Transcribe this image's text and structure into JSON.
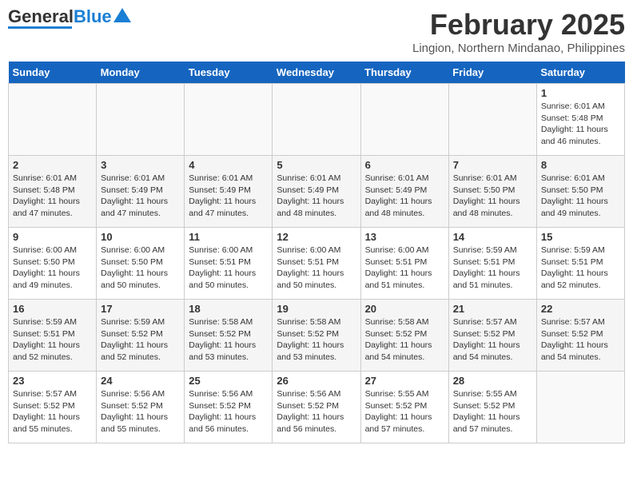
{
  "header": {
    "logo_text_general": "General",
    "logo_text_blue": "Blue",
    "month_year": "February 2025",
    "location": "Lingion, Northern Mindanao, Philippines"
  },
  "weekdays": [
    "Sunday",
    "Monday",
    "Tuesday",
    "Wednesday",
    "Thursday",
    "Friday",
    "Saturday"
  ],
  "weeks": [
    [
      {
        "day": "",
        "info": ""
      },
      {
        "day": "",
        "info": ""
      },
      {
        "day": "",
        "info": ""
      },
      {
        "day": "",
        "info": ""
      },
      {
        "day": "",
        "info": ""
      },
      {
        "day": "",
        "info": ""
      },
      {
        "day": "1",
        "info": "Sunrise: 6:01 AM\nSunset: 5:48 PM\nDaylight: 11 hours and 46 minutes."
      }
    ],
    [
      {
        "day": "2",
        "info": "Sunrise: 6:01 AM\nSunset: 5:48 PM\nDaylight: 11 hours and 47 minutes."
      },
      {
        "day": "3",
        "info": "Sunrise: 6:01 AM\nSunset: 5:49 PM\nDaylight: 11 hours and 47 minutes."
      },
      {
        "day": "4",
        "info": "Sunrise: 6:01 AM\nSunset: 5:49 PM\nDaylight: 11 hours and 47 minutes."
      },
      {
        "day": "5",
        "info": "Sunrise: 6:01 AM\nSunset: 5:49 PM\nDaylight: 11 hours and 48 minutes."
      },
      {
        "day": "6",
        "info": "Sunrise: 6:01 AM\nSunset: 5:49 PM\nDaylight: 11 hours and 48 minutes."
      },
      {
        "day": "7",
        "info": "Sunrise: 6:01 AM\nSunset: 5:50 PM\nDaylight: 11 hours and 48 minutes."
      },
      {
        "day": "8",
        "info": "Sunrise: 6:01 AM\nSunset: 5:50 PM\nDaylight: 11 hours and 49 minutes."
      }
    ],
    [
      {
        "day": "9",
        "info": "Sunrise: 6:00 AM\nSunset: 5:50 PM\nDaylight: 11 hours and 49 minutes."
      },
      {
        "day": "10",
        "info": "Sunrise: 6:00 AM\nSunset: 5:50 PM\nDaylight: 11 hours and 50 minutes."
      },
      {
        "day": "11",
        "info": "Sunrise: 6:00 AM\nSunset: 5:51 PM\nDaylight: 11 hours and 50 minutes."
      },
      {
        "day": "12",
        "info": "Sunrise: 6:00 AM\nSunset: 5:51 PM\nDaylight: 11 hours and 50 minutes."
      },
      {
        "day": "13",
        "info": "Sunrise: 6:00 AM\nSunset: 5:51 PM\nDaylight: 11 hours and 51 minutes."
      },
      {
        "day": "14",
        "info": "Sunrise: 5:59 AM\nSunset: 5:51 PM\nDaylight: 11 hours and 51 minutes."
      },
      {
        "day": "15",
        "info": "Sunrise: 5:59 AM\nSunset: 5:51 PM\nDaylight: 11 hours and 52 minutes."
      }
    ],
    [
      {
        "day": "16",
        "info": "Sunrise: 5:59 AM\nSunset: 5:51 PM\nDaylight: 11 hours and 52 minutes."
      },
      {
        "day": "17",
        "info": "Sunrise: 5:59 AM\nSunset: 5:52 PM\nDaylight: 11 hours and 52 minutes."
      },
      {
        "day": "18",
        "info": "Sunrise: 5:58 AM\nSunset: 5:52 PM\nDaylight: 11 hours and 53 minutes."
      },
      {
        "day": "19",
        "info": "Sunrise: 5:58 AM\nSunset: 5:52 PM\nDaylight: 11 hours and 53 minutes."
      },
      {
        "day": "20",
        "info": "Sunrise: 5:58 AM\nSunset: 5:52 PM\nDaylight: 11 hours and 54 minutes."
      },
      {
        "day": "21",
        "info": "Sunrise: 5:57 AM\nSunset: 5:52 PM\nDaylight: 11 hours and 54 minutes."
      },
      {
        "day": "22",
        "info": "Sunrise: 5:57 AM\nSunset: 5:52 PM\nDaylight: 11 hours and 54 minutes."
      }
    ],
    [
      {
        "day": "23",
        "info": "Sunrise: 5:57 AM\nSunset: 5:52 PM\nDaylight: 11 hours and 55 minutes."
      },
      {
        "day": "24",
        "info": "Sunrise: 5:56 AM\nSunset: 5:52 PM\nDaylight: 11 hours and 55 minutes."
      },
      {
        "day": "25",
        "info": "Sunrise: 5:56 AM\nSunset: 5:52 PM\nDaylight: 11 hours and 56 minutes."
      },
      {
        "day": "26",
        "info": "Sunrise: 5:56 AM\nSunset: 5:52 PM\nDaylight: 11 hours and 56 minutes."
      },
      {
        "day": "27",
        "info": "Sunrise: 5:55 AM\nSunset: 5:52 PM\nDaylight: 11 hours and 57 minutes."
      },
      {
        "day": "28",
        "info": "Sunrise: 5:55 AM\nSunset: 5:52 PM\nDaylight: 11 hours and 57 minutes."
      },
      {
        "day": "",
        "info": ""
      }
    ]
  ]
}
